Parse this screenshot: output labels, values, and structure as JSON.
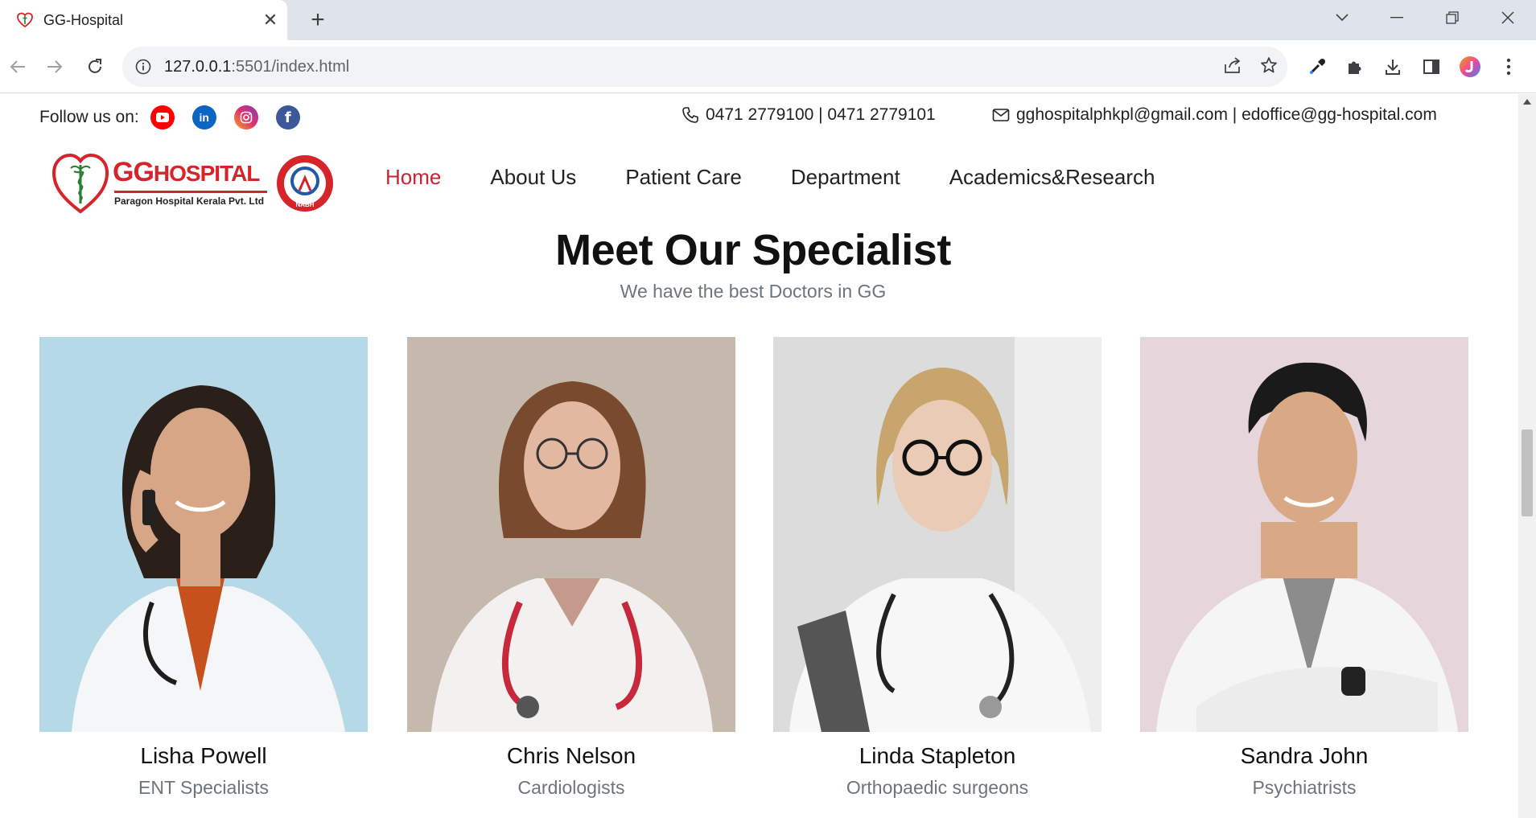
{
  "browser": {
    "tab_title": "GG-Hospital",
    "url_host": "127.0.0.1",
    "url_path": ":5501/index.html"
  },
  "topbar": {
    "follow_label": "Follow us on:",
    "social_icons": [
      "youtube-icon",
      "linkedin-icon",
      "instagram-icon",
      "facebook-icon"
    ],
    "phone": "0471 2779100 | 0471 2779101",
    "email": "gghospitalphkpl@gmail.com | edoffice@gg-hospital.com"
  },
  "logo": {
    "main": "GGHOSPITAL",
    "sub": "Paragon Hospital Kerala Pvt. Ltd",
    "badge": "NABH"
  },
  "nav": {
    "items": [
      "Home",
      "About Us",
      "Patient Care",
      "Department",
      "Academics&Research"
    ],
    "active": "Home"
  },
  "specialists": {
    "title": "Meet Our Specialist",
    "subtitle": "We have the best Doctors in GG",
    "doctors": [
      {
        "name": "Lisha Powell",
        "role": "ENT Specialists"
      },
      {
        "name": "Chris Nelson",
        "role": "Cardiologists"
      },
      {
        "name": "Linda Stapleton",
        "role": "Orthopaedic surgeons"
      },
      {
        "name": "Sandra John",
        "role": "Psychiatrists"
      }
    ]
  },
  "colors": {
    "accent": "#c82333",
    "brand_red": "#d6242b",
    "muted": "#6c757d"
  }
}
